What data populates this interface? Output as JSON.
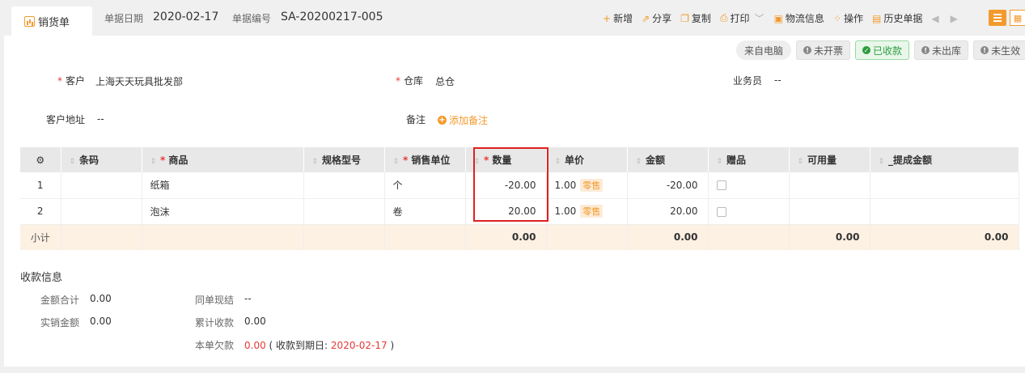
{
  "header": {
    "tab_label": "销货单",
    "date_label": "单据日期",
    "date_value": "2020-02-17",
    "no_label": "单据编号",
    "no_value": "SA-20200217-005"
  },
  "toolbar": {
    "add": "新增",
    "share": "分享",
    "copy": "复制",
    "print": "打印",
    "logistics": "物流信息",
    "ops": "操作",
    "history": "历史单据"
  },
  "badges": {
    "source": "来自电脑",
    "invoice": "未开票",
    "received": "已收款",
    "outbound": "未出库",
    "effective": "未生效"
  },
  "form": {
    "customer_label": "客户",
    "customer_value": "上海天天玩具批发部",
    "warehouse_label": "仓库",
    "warehouse_value": "总仓",
    "staff_label": "业务员",
    "staff_value": "--",
    "address_label": "客户地址",
    "address_value": "--",
    "remark_label": "备注",
    "add_remark": "添加备注"
  },
  "table": {
    "columns": {
      "barcode": "条码",
      "product": "商品",
      "spec": "规格型号",
      "unit": "销售单位",
      "qty": "数量",
      "price": "单价",
      "amount": "金额",
      "gift": "赠品",
      "available": "可用量",
      "commission": "_提成金额"
    },
    "rows": [
      {
        "idx": "1",
        "barcode": "",
        "product": "纸箱",
        "spec": "",
        "unit": "个",
        "qty": "-20.00",
        "price": "1.00",
        "price_tag": "零售",
        "amount": "-20.00",
        "available": "",
        "commission": ""
      },
      {
        "idx": "2",
        "barcode": "",
        "product": "泡沫",
        "spec": "",
        "unit": "卷",
        "qty": "20.00",
        "price": "1.00",
        "price_tag": "零售",
        "amount": "20.00",
        "available": "",
        "commission": ""
      }
    ],
    "subtotal": {
      "label": "小计",
      "qty": "0.00",
      "amount": "0.00",
      "available": "0.00",
      "commission": "0.00"
    }
  },
  "payment": {
    "title": "收款信息",
    "total_label": "金额合计",
    "total_value": "0.00",
    "actual_label": "实销金额",
    "actual_value": "0.00",
    "cash_label": "同单现结",
    "cash_value": "--",
    "cumulative_label": "累计收款",
    "cumulative_value": "0.00",
    "owed_label": "本单欠款",
    "owed_value": "0.00",
    "due_prefix": "( 收款到期日:",
    "due_date": "2020-02-17",
    "due_suffix": ")"
  },
  "colors": {
    "accent": "#f39a2c",
    "required": "#e53935",
    "success": "#2d9c3f",
    "highlight_box": "#e02020"
  }
}
